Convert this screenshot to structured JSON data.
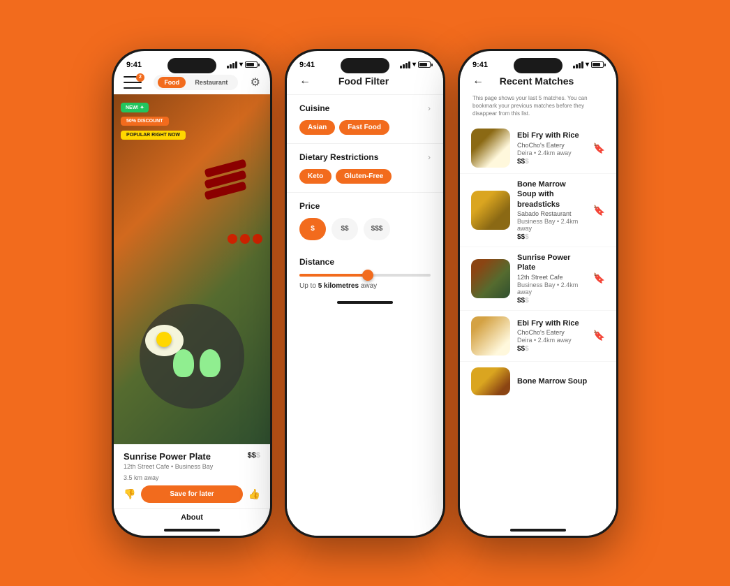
{
  "background_color": "#F26B1D",
  "phones": {
    "phone1": {
      "status_time": "9:41",
      "header": {
        "badge_count": "2",
        "tab_food": "Food",
        "tab_restaurant": "Restaurant"
      },
      "badges": {
        "new": "NEW! ✦",
        "discount": "50% DISCOUNT",
        "popular": "POPULAR RIGHT NOW"
      },
      "food": {
        "name": "Sunrise Power Plate",
        "price": "$$",
        "price_dim": "$",
        "meta_line1": "12th Street Cafe • Business Bay",
        "meta_line2": "3.5 km away",
        "save_btn": "Save for later"
      },
      "about_tab": "About"
    },
    "phone2": {
      "status_time": "9:41",
      "title": "Food Filter",
      "sections": {
        "cuisine": {
          "label": "Cuisine",
          "tags": [
            "Asian",
            "Fast Food"
          ]
        },
        "dietary": {
          "label": "Dietary Restrictions",
          "tags": [
            "Keto",
            "Gluten-Free"
          ]
        },
        "price": {
          "label": "Price",
          "buttons": [
            "$",
            "$$",
            "$$$"
          ]
        },
        "distance": {
          "label": "Distance",
          "value": "5",
          "unit": "kilometres",
          "text_prefix": "Up to ",
          "text_suffix": " away"
        }
      }
    },
    "phone3": {
      "status_time": "9:41",
      "title": "Recent Matches",
      "subtitle": "This page shows your last 5 matches. You can bookmark your previous matches before they disappear from this list.",
      "matches": [
        {
          "name": "Ebi Fry with Rice",
          "restaurant": "ChoCho's Eatery",
          "location": "Deira • 2.4km away",
          "price": "$$",
          "price_dim": "$",
          "bookmarked": true,
          "img_class": "img-ebi-fry"
        },
        {
          "name": "Bone Marrow Soup with breadsticks",
          "restaurant": "Sabado Restaurant",
          "location": "Business Bay • 2.4km away",
          "price": "$$",
          "price_dim": "$",
          "bookmarked": false,
          "img_class": "img-bone-marrow"
        },
        {
          "name": "Sunrise Power Plate",
          "restaurant": "12th Street Cafe",
          "location": "Business Bay • 2.4km away",
          "price": "$$",
          "price_dim": "$",
          "bookmarked": false,
          "img_class": "img-sunrise"
        },
        {
          "name": "Ebi Fry with Rice",
          "restaurant": "ChoCho's Eatery",
          "location": "Deira • 2.4km away",
          "price": "$$",
          "price_dim": "$",
          "bookmarked": true,
          "img_class": "img-ebi-fry2"
        }
      ],
      "partial": {
        "name": "Bone Marrow Soup",
        "img_class": "img-bone-marrow2"
      }
    }
  }
}
